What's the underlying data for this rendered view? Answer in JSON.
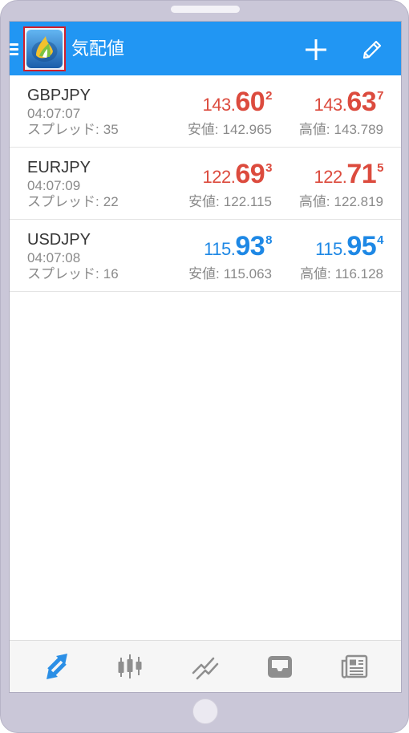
{
  "header": {
    "title": "気配値",
    "color": "#2196f3",
    "highlight_color": "#d21f2b"
  },
  "icons": {
    "menu": "hamburger-menu-icon",
    "logo": "metatrader-app-logo",
    "add": "plus-icon",
    "edit": "pencil-icon"
  },
  "quotes": [
    {
      "symbol": "GBPJPY",
      "time": "04:07:07",
      "spread_label": "スプレッド:",
      "spread": "35",
      "bid": {
        "main": "143.",
        "big": "60",
        "small": "2"
      },
      "ask": {
        "main": "143.",
        "big": "63",
        "small": "7"
      },
      "low_label": "安値:",
      "low": "142.965",
      "high_label": "高値:",
      "high": "143.789",
      "color": "#dc4b3e"
    },
    {
      "symbol": "EURJPY",
      "time": "04:07:09",
      "spread_label": "スプレッド:",
      "spread": "22",
      "bid": {
        "main": "122.",
        "big": "69",
        "small": "3"
      },
      "ask": {
        "main": "122.",
        "big": "71",
        "small": "5"
      },
      "low_label": "安値:",
      "low": "122.115",
      "high_label": "高値:",
      "high": "122.819",
      "color": "#dc4b3e"
    },
    {
      "symbol": "USDJPY",
      "time": "04:07:08",
      "spread_label": "スプレッド:",
      "spread": "16",
      "bid": {
        "main": "115.",
        "big": "93",
        "small": "8"
      },
      "ask": {
        "main": "115.",
        "big": "95",
        "small": "4"
      },
      "low_label": "安値:",
      "low": "115.063",
      "high_label": "高値:",
      "high": "116.128",
      "color": "#1e88e5"
    }
  ],
  "bottom_nav": {
    "active_color": "#2b8fe6",
    "inactive_color": "#8e8e8e",
    "items": [
      {
        "icon": "quotes-arrows-icon",
        "active": true
      },
      {
        "icon": "candlestick-chart-icon",
        "active": false
      },
      {
        "icon": "trade-line-icon",
        "active": false
      },
      {
        "icon": "history-inbox-icon",
        "active": false
      },
      {
        "icon": "news-icon",
        "active": false
      }
    ]
  }
}
